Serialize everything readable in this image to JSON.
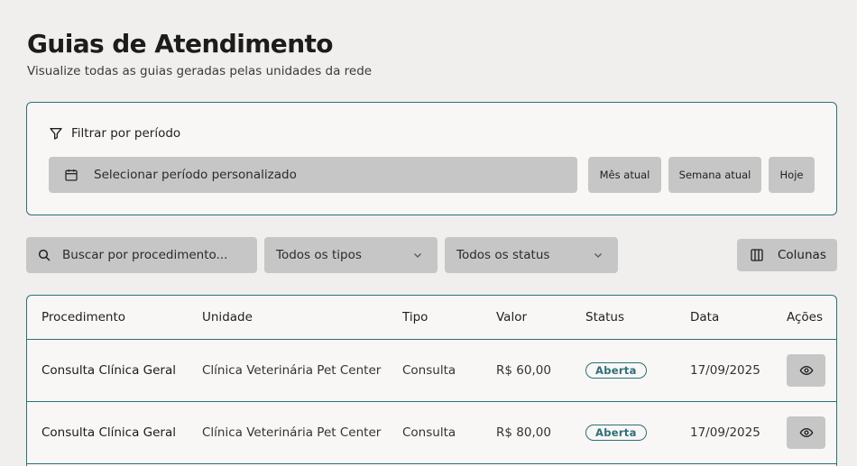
{
  "header": {
    "title": "Guias de Atendimento",
    "subtitle": "Visualize todas as guias geradas pelas unidades da rede"
  },
  "filter": {
    "label": "Filtrar por período",
    "period_placeholder": "Selecionar período personalizado",
    "quick_buttons": [
      "Mês atual",
      "Semana atual",
      "Hoje"
    ]
  },
  "toolbar": {
    "search_placeholder": "Buscar por procedimento...",
    "type_select": "Todos os tipos",
    "status_select": "Todos os status",
    "columns_label": "Colunas"
  },
  "table": {
    "columns": [
      "Procedimento",
      "Unidade",
      "Tipo",
      "Valor",
      "Status",
      "Data",
      "Ações"
    ],
    "rows": [
      {
        "procedimento": "Consulta Clínica Geral",
        "unidade": "Clínica Veterinária Pet Center",
        "tipo": "Consulta",
        "valor": "R$ 60,00",
        "status": "Aberta",
        "data": "17/09/2025"
      },
      {
        "procedimento": "Consulta Clínica Geral",
        "unidade": "Clínica Veterinária Pet Center",
        "tipo": "Consulta",
        "valor": "R$ 80,00",
        "status": "Aberta",
        "data": "17/09/2025"
      }
    ]
  },
  "colors": {
    "accent": "#2d6f78",
    "control_bg": "#c6c6c6",
    "page_bg": "#f0efed"
  },
  "icons": [
    "filter-icon",
    "calendar-icon",
    "search-icon",
    "chevron-down-icon",
    "columns-icon",
    "eye-icon"
  ]
}
